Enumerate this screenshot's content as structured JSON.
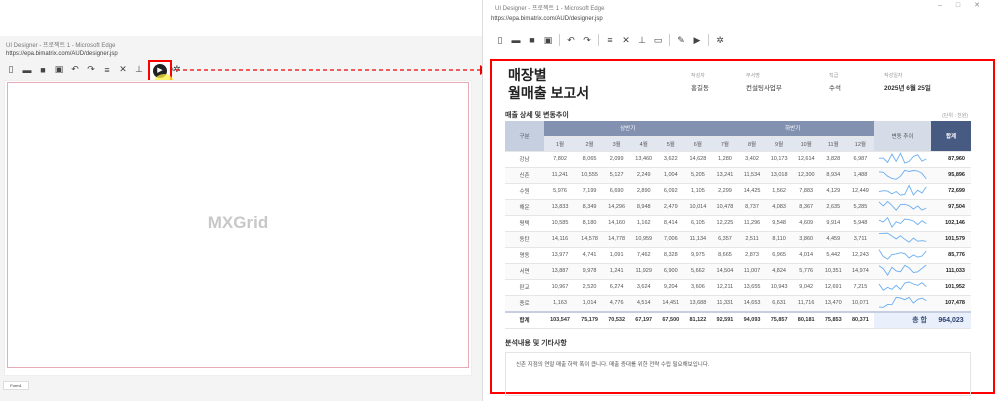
{
  "left_window": {
    "title": "UI Designer - 프로젝트 1 - Microsoft Edge",
    "url": "https://epa.bimatrix.com/AUD/designer.jsp",
    "canvas_label": "MXGrid",
    "tab": "Form1",
    "toolbar_icons": [
      "new-file-icon",
      "open-folder-icon",
      "save-icon",
      "save-all-icon",
      "undo-icon",
      "redo-icon",
      "database-icon",
      "tools-icon",
      "hierarchy-icon",
      "code-window-icon",
      "edit-icon",
      "play-icon",
      "gear-icon"
    ],
    "highlight_color": "#ff0000"
  },
  "right_window": {
    "title": "UI Designer - 프로젝트 1 - Microsoft Edge",
    "url": "https://epa.bimatrix.com/AUD/designer.jsp"
  },
  "report": {
    "title_line1": "매장별",
    "title_line2": "월매출 보고서",
    "meta": [
      {
        "label": "작성자",
        "value": "홍길동"
      },
      {
        "label": "부서명",
        "value": "컨설팅사업부"
      },
      {
        "label": "직급",
        "value": "수석"
      },
      {
        "label": "작성일자",
        "value": "2025년 6월 25일"
      }
    ],
    "section_title": "매출 상세 및 변동추이",
    "unit": "(단위 : 천원)",
    "headers": {
      "category": "구분",
      "first_half": "상반기",
      "second_half": "하반기",
      "trend": "변동 추이",
      "total": "합계",
      "months": [
        "1월",
        "2월",
        "3월",
        "4월",
        "5월",
        "6월",
        "7월",
        "8월",
        "9월",
        "10월",
        "11월",
        "12월"
      ]
    },
    "rows": [
      {
        "name": "강남",
        "m": [
          "7,802",
          "8,065",
          "2,099",
          "13,460",
          "3,622",
          "14,628",
          "1,280",
          "3,402",
          "10,173",
          "12,614",
          "3,828",
          "6,987"
        ],
        "total": "87,960"
      },
      {
        "name": "신촌",
        "m": [
          "11,241",
          "10,555",
          "5,127",
          "2,249",
          "1,004",
          "5,205",
          "13,241",
          "11,534",
          "13,018",
          "12,300",
          "8,934",
          "1,488"
        ],
        "total": "95,896"
      },
      {
        "name": "수원",
        "m": [
          "5,976",
          "7,199",
          "6,690",
          "2,890",
          "6,092",
          "1,105",
          "2,299",
          "14,425",
          "1,562",
          "7,883",
          "4,129",
          "12,449"
        ],
        "total": "72,699"
      },
      {
        "name": "해운",
        "m": [
          "13,833",
          "8,349",
          "14,296",
          "8,948",
          "2,479",
          "10,014",
          "10,478",
          "8,737",
          "4,083",
          "8,367",
          "2,635",
          "5,285"
        ],
        "total": "97,504"
      },
      {
        "name": "평택",
        "m": [
          "10,585",
          "8,180",
          "14,160",
          "1,162",
          "8,414",
          "6,105",
          "12,225",
          "11,296",
          "9,548",
          "4,609",
          "9,914",
          "5,948"
        ],
        "total": "102,146"
      },
      {
        "name": "동탄",
        "m": [
          "14,116",
          "14,578",
          "14,778",
          "10,959",
          "7,006",
          "11,134",
          "6,357",
          "2,511",
          "8,110",
          "3,860",
          "4,459",
          "3,711"
        ],
        "total": "101,579"
      },
      {
        "name": "명동",
        "m": [
          "13,977",
          "4,741",
          "1,091",
          "7,462",
          "8,328",
          "9,975",
          "8,665",
          "2,873",
          "6,965",
          "4,014",
          "5,442",
          "12,243"
        ],
        "total": "85,776"
      },
      {
        "name": "서면",
        "m": [
          "13,887",
          "9,978",
          "1,241",
          "11,929",
          "6,900",
          "5,662",
          "14,504",
          "11,007",
          "4,824",
          "5,776",
          "10,351",
          "14,974"
        ],
        "total": "111,033"
      },
      {
        "name": "판교",
        "m": [
          "10,967",
          "2,520",
          "6,274",
          "3,624",
          "9,204",
          "3,606",
          "12,211",
          "13,655",
          "10,943",
          "9,042",
          "12,691",
          "7,215"
        ],
        "total": "101,952"
      },
      {
        "name": "종로",
        "m": [
          "1,163",
          "1,014",
          "4,776",
          "4,514",
          "14,451",
          "13,688",
          "11,331",
          "14,653",
          "6,631",
          "11,716",
          "13,470",
          "10,071"
        ],
        "total": "107,478"
      }
    ],
    "sum_row": {
      "label": "합계",
      "m": [
        "103,547",
        "75,179",
        "70,532",
        "67,197",
        "67,500",
        "81,122",
        "92,591",
        "94,093",
        "75,857",
        "80,181",
        "75,853",
        "80,371"
      ],
      "grand_label": "총 합",
      "grand_total": "964,023"
    },
    "analysis_title": "분석내용 및 기타사항",
    "analysis_text": "신촌 지점의 연말 매출 하락 폭이 큽니다. 매출 증대를 위한 전략 수립 필요해보입니다."
  },
  "colors": {
    "header": "#8391b0",
    "total_header": "#465a82",
    "sparkline": "#6aaef0",
    "border_highlight": "#ff0000"
  }
}
